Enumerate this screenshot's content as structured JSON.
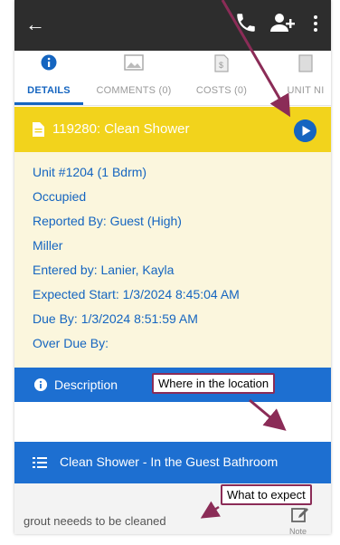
{
  "topbar": {
    "back_icon": "arrow-left-icon",
    "phone_icon": "phone-icon",
    "add_user_icon": "add-user-icon",
    "more_icon": "more-vertical-icon",
    "background": "#2d2d2d"
  },
  "tabs": [
    {
      "label": "DETAILS",
      "icon": "info-circle-icon",
      "active": true
    },
    {
      "label": "COMMENTS (0)",
      "icon": "image-icon",
      "active": false
    },
    {
      "label": "COSTS (0)",
      "icon": "receipt-icon",
      "active": false
    },
    {
      "label": "UNIT NI",
      "icon": "document-icon",
      "active": false
    }
  ],
  "work_order": {
    "title": "119280: Clean Shower",
    "header_color": "#f2d31c",
    "details": [
      "Unit #1204 (1 Bdrm)",
      "Occupied",
      "Reported By: Guest  (High)",
      "Miller",
      "Entered by: Lanier, Kayla",
      "Expected Start: 1/3/2024 8:45:04 AM",
      "Due By: 1/3/2024 8:51:59 AM",
      "Over Due By:"
    ]
  },
  "description": {
    "label": "Description",
    "bar_color": "#1d6fd1"
  },
  "task": {
    "label": "Clean Shower - In the Guest Bathroom"
  },
  "notes": {
    "text": "grout neeeds to be cleaned",
    "note_label": "Note"
  },
  "callouts": {
    "location": "Where in the location",
    "expect": "What to expect",
    "color": "#8b2c57"
  }
}
